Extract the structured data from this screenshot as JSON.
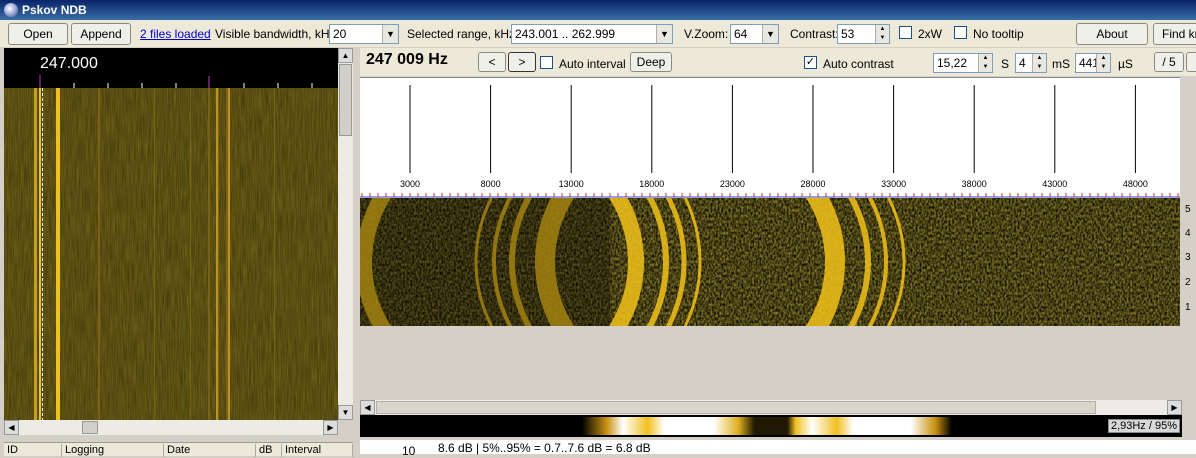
{
  "window": {
    "title": "Pskov NDB"
  },
  "toolbar": {
    "open_label": "Open",
    "append_label": "Append",
    "files_loaded_link": "2 files loaded",
    "visible_bw_label": "Visible bandwidth, kHz:",
    "visible_bw_value": "20",
    "selected_range_label": "Selected range, kHz:",
    "selected_range_value": "243.001 .. 262.999",
    "vzoom_label": "V.Zoom:",
    "vzoom_value": "64",
    "contrast_label": "Contrast:",
    "contrast_value": "53",
    "twoxw_label": "2xW",
    "twoxw_checked": false,
    "no_tooltip_label": "No tooltip",
    "no_tooltip_checked": false,
    "about_label": "About",
    "find_label": "Find kn"
  },
  "left_panel": {
    "frequency": "247.000"
  },
  "table": {
    "columns": [
      "ID",
      "Logging",
      "Date",
      "dB",
      "Interval"
    ]
  },
  "right_toolbar": {
    "frequency_readout": "247 009 Hz",
    "prev_label": "<",
    "next_label": ">",
    "auto_interval_label": "Auto interval",
    "auto_interval_checked": false,
    "deep_label": "Deep",
    "auto_contrast_label": "Auto contrast",
    "auto_contrast_checked": true,
    "seconds_value": "15,22",
    "seconds_unit": "S",
    "ms_value": "4",
    "ms_unit": "mS",
    "us_value": "441",
    "us_unit": "µS",
    "divide_label": "/ 5"
  },
  "spectrum": {
    "x_ticks": [
      "3000",
      "8000",
      "13000",
      "18000",
      "23000",
      "28000",
      "33000",
      "38000",
      "43000",
      "48000"
    ]
  },
  "right_edge_labels": [
    "5",
    "4",
    "3",
    "2",
    "1"
  ],
  "signal_bar": {
    "label": "2,93Hz / 95%"
  },
  "bottom_info": {
    "row_number": "10",
    "text": "8.6 dB | 5%..95% = 0.7..7.6 dB = 6.8 dB"
  },
  "colors": {
    "waterfall_bg": "#3a3208",
    "signal_yellow": "#f0c020",
    "title_bar": "#0a246a"
  }
}
